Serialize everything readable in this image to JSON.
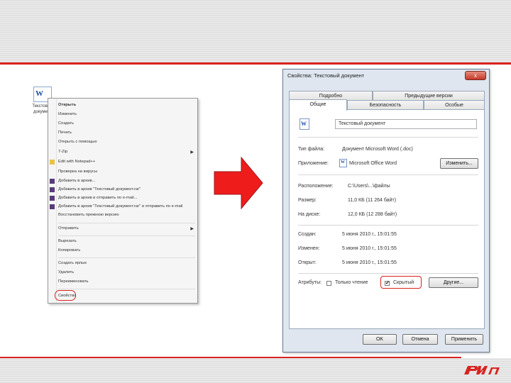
{
  "desktop": {
    "file_caption": "Текстовый документ"
  },
  "context_menu": {
    "items": [
      {
        "label": "Открыть",
        "bold": true
      },
      {
        "label": "Изменить"
      },
      {
        "label": "Создать"
      },
      {
        "label": "Печать"
      },
      {
        "label": "Открыть с помощью"
      },
      {
        "label": "7-Zip",
        "submenu": true
      },
      {
        "label": "Edit with Notepad++"
      },
      {
        "label": "Проверка на вирусы"
      },
      {
        "label": "Добавить в архив..."
      },
      {
        "label": "Добавить в архив \"Текстовый документ.rar\""
      },
      {
        "label": "Добавить в архив и отправить по e-mail..."
      },
      {
        "label": "Добавить в архив \"Текстовый документ.rar\" и отправить по e-mail"
      },
      {
        "label": "Восстановить прежнюю версию"
      },
      {
        "label": "Отправить",
        "submenu": true
      },
      {
        "label": "Вырезать"
      },
      {
        "label": "Копировать"
      },
      {
        "label": "Создать ярлык"
      },
      {
        "label": "Удалить"
      },
      {
        "label": "Переименовать"
      },
      {
        "label": "Свойства"
      }
    ]
  },
  "dialog": {
    "title": "Свойства: Текстовый документ",
    "close_label": "x",
    "tabs_row1": [
      "Подробно",
      "Предыдущие версии"
    ],
    "tabs_row2": [
      "Общие",
      "Безопасность",
      "Особые"
    ],
    "file_name": "Текстовый документ",
    "type_label": "Тип файла:",
    "type_value": "Документ Microsoft Word (.doc)",
    "app_label": "Приложение:",
    "app_value": "Microsoft Office Word",
    "change_button": "Изменить...",
    "location_label": "Расположение:",
    "location_value": "C:\\Users\\...\\файлы",
    "size_label": "Размер:",
    "size_value": "11,0 КБ (11 264 байт)",
    "disk_label": "На диске:",
    "disk_value": "12,0 КБ (12 288 байт)",
    "created_label": "Создан:",
    "created_value": "5 июня 2010 г., 15:01:55",
    "modified_label": "Изменен:",
    "modified_value": "5 июня 2010 г., 15:01:55",
    "opened_label": "Открыт:",
    "opened_value": "5 июня 2010 г., 15:01:55",
    "attributes_label": "Атрибуты:",
    "readonly_label": "Только чтение",
    "hidden_label": "Скрытый",
    "other_button": "Другие...",
    "ok_button": "OK",
    "cancel_button": "Отмена",
    "apply_button": "Применить"
  },
  "colors": {
    "accent_red": "#d9231f",
    "dialog_bg": "#dfe6ef"
  }
}
